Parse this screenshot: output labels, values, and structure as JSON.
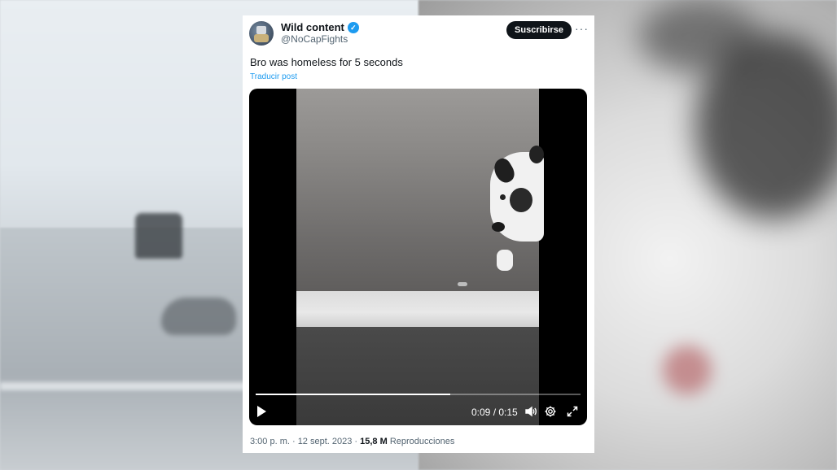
{
  "tweet": {
    "author_name": "Wild content",
    "author_handle": "@NoCapFights",
    "subscribe_label": "Suscribirse",
    "more_label": "···",
    "text": "Bro was homeless for 5 seconds",
    "translate_label": "Traducir post",
    "posted_at": "3:00 p. m. · 12 sept. 2023 ·",
    "views_count": "15,8 M",
    "views_label": "Reproducciones"
  },
  "video": {
    "current_time": "0:09",
    "time_separator": " / ",
    "duration": "0:15",
    "progress_fraction": 0.6,
    "controls": {
      "play": "play-icon",
      "volume": "volume-icon",
      "settings": "settings-icon",
      "fullscreen": "fullscreen-icon"
    }
  },
  "colors": {
    "accent": "#1d9bf0",
    "button_bg": "#0f1419",
    "secondary_text": "#536471"
  }
}
